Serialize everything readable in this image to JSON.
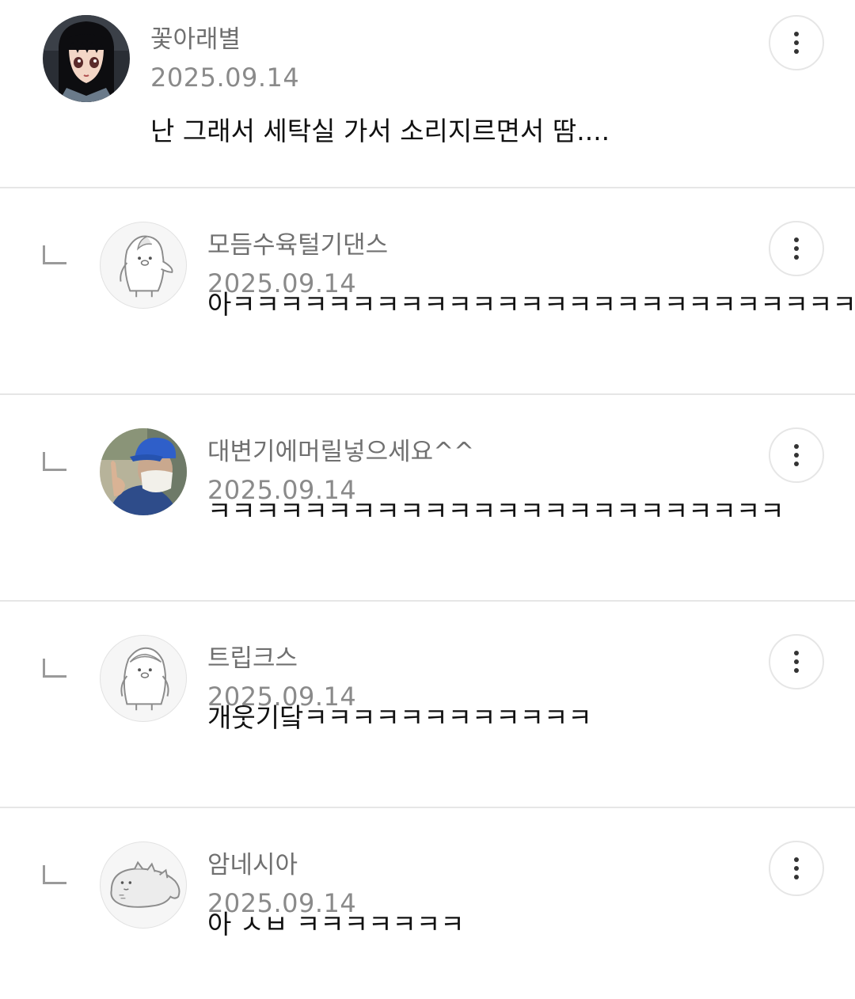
{
  "comments": [
    {
      "type": "comment",
      "nickname": "꽃아래별",
      "date": "2025.09.14",
      "text": "난 그래서 세탁실 가서 소리지르면서 땀....",
      "avatar": "anime-girl-avatar"
    },
    {
      "type": "reply",
      "nickname": "모듬수육털기댄스",
      "date": "2025.09.14",
      "text": "아ㅋㅋㅋㅋㅋㅋㅋㅋㅋㅋㅋㅋㅋㅋㅋㅋㅋㅋㅋㅋㅋㅋㅋㅋㅋㅋ",
      "avatar": "penguin-default-avatar"
    },
    {
      "type": "reply",
      "nickname": "대변기에머릴넣으세요^^",
      "date": "2025.09.14",
      "text": "ㅋㅋㅋㅋㅋㅋㅋㅋㅋㅋㅋㅋㅋㅋㅋㅋㅋㅋㅋㅋㅋㅋㅋㅋ",
      "avatar": "masked-person-photo-avatar"
    },
    {
      "type": "reply",
      "nickname": "트립크스",
      "date": "2025.09.14",
      "text": "개웃기닼ㅋㅋㅋㅋㅋㅋㅋㅋㅋㅋㅋㅋ",
      "avatar": "penguin-default-avatar"
    },
    {
      "type": "reply",
      "nickname": "암네시아",
      "date": "2025.09.14",
      "text": "아 ㅅㅂ ㅋㅋㅋㅋㅋㅋㅋ",
      "avatar": "dinosaur-default-avatar"
    }
  ],
  "icons": {
    "more": "more-vertical-icon",
    "reply": "reply-arrow-icon"
  },
  "colors": {
    "nickname": "#707070",
    "date": "#8a8a8a",
    "divider": "#e6e6e6",
    "text": "#111111"
  }
}
